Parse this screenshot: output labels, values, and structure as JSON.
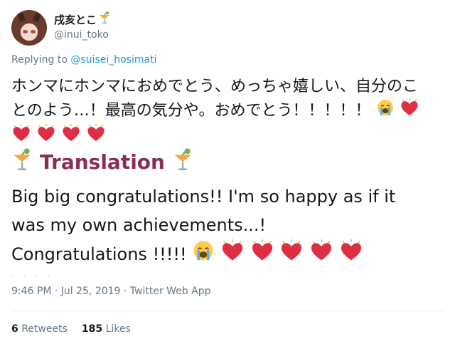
{
  "user": {
    "display_name": "戌亥とこ",
    "handle": "@inui_toko"
  },
  "reply": {
    "prefix": "Replying to",
    "mention": "@suisei_hosimati"
  },
  "tweet": {
    "text_line1": "ホンマにホンマにおめでとう、めっちゃ嬉しい、自分のこ",
    "text_line2": "とのよう…！最高の気分や。おめでとう！！！！！"
  },
  "translation": {
    "title": "Translation",
    "line1": "Big big congratulations!! I'm so happy as if it",
    "line2": "was my own achievements...!",
    "line3": "Congratulations !!!!!"
  },
  "meta": {
    "timestamp": "9:46 PM · Jul 25, 2019 · Twitter Web App"
  },
  "stats": {
    "retweets_count": "6",
    "retweets_label": "Retweets",
    "likes_count": "185",
    "likes_label": "Likes"
  },
  "icons": {
    "drink": "tropical-drink-icon",
    "cry": "loudly-crying-face-icon",
    "heart": "heart-with-sparkle-icon"
  },
  "colors": {
    "mention": "#1b95e0",
    "translation_title": "#8b2e55",
    "heart": "#dd2e44",
    "muted": "#657786"
  }
}
